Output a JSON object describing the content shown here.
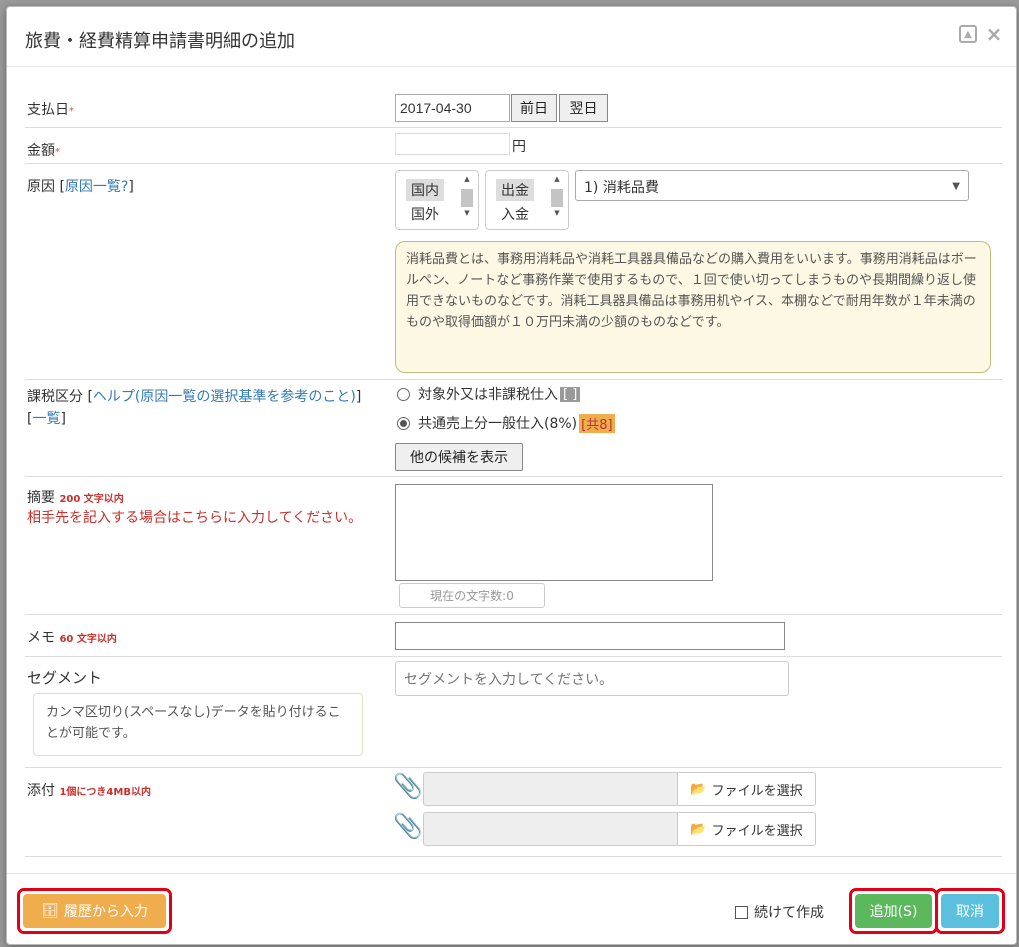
{
  "modal": {
    "title": "旅費・経費精算申請書明細の追加"
  },
  "payment_date": {
    "label": "支払日",
    "required_mark": "*",
    "value": "2017-04-30",
    "prev_label": "前日",
    "next_label": "翌日"
  },
  "amount": {
    "label": "金額",
    "required_mark": "*",
    "value": "",
    "unit": "円"
  },
  "reason": {
    "label": "原因",
    "link_open": "[",
    "link_text": "原因一覧?",
    "link_close": "]",
    "region_options": [
      "国内",
      "国外"
    ],
    "region_selected": "国内",
    "flow_options": [
      "出金",
      "入金"
    ],
    "flow_selected": "出金",
    "category_selected": "1) 消耗品費",
    "description": "消耗品費とは、事務用消耗品や消耗工具器具備品などの購入費用をいいます。事務用消耗品はボールペン、ノートなど事務作業で使用するもので、１回で使い切ってしまうものや長期間繰り返し使用できないものなどです。消耗工具器具備品は事務用机やイス、本棚などで耐用年数が１年未満のものや取得価額が１０万円未満の少額のものなどです。"
  },
  "tax": {
    "label": "課税区分",
    "help_link": "ヘルプ(原因一覧の選択基準を参考のこと)",
    "list_link": "一覧",
    "options": [
      {
        "label": "対象外又は非課税仕入",
        "tag": "[  ]",
        "checked": false
      },
      {
        "label": "共通売上分一般仕入(8%)",
        "tag": "[共8]",
        "checked": true
      }
    ],
    "more_button": "他の候補を表示"
  },
  "summary": {
    "label": "摘要",
    "limit": "200 文字以内",
    "note": "相手先を記入する場合はこちらに入力してください。",
    "value": "",
    "counter": "現在の文字数:0"
  },
  "memo": {
    "label": "メモ",
    "limit": "60 文字以内",
    "value": ""
  },
  "segment": {
    "label": "セグメント",
    "placeholder": "セグメントを入力してください。",
    "note": "カンマ区切り(スペースなし)データを貼り付けることが可能です。"
  },
  "attachment": {
    "label": "添付",
    "limit": "1個につき4MB以内",
    "file_button": "ファイルを選択",
    "slots": 2
  },
  "footer": {
    "history_button": "履歴から入力",
    "continue_label": "続けて作成",
    "add_button": "追加(S)",
    "cancel_button": "取消"
  },
  "colors": {
    "orange": "#f0ad4e",
    "green": "#5cb85c",
    "blue": "#5bc0de",
    "highlight": "#e0001a"
  }
}
